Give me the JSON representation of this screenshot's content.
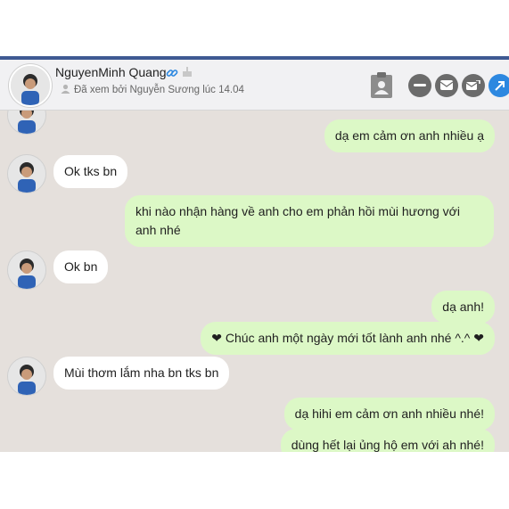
{
  "header": {
    "contact_name": "NguyenMinh Quang",
    "seen_text": "Đã xem bởi Nguyễn Sương lúc 14.04",
    "icons": [
      "verified-link-icon",
      "cake-icon",
      "clipboard-user-icon",
      "minimize-icon",
      "chat-bubbles-icon",
      "add-to-chat-icon",
      "share-icon"
    ]
  },
  "messages": [
    {
      "side": "out",
      "text": "dạ em cảm ơn anh nhiều ạ"
    },
    {
      "side": "in",
      "text": "Ok tks bn"
    },
    {
      "side": "out",
      "text": "khi nào nhận hàng về anh cho em phản hồi mùi hương với anh nhé"
    },
    {
      "side": "in",
      "text": "Ok bn"
    },
    {
      "side": "out",
      "text": "dạ anh!"
    },
    {
      "side": "out",
      "text": "❤ Chúc anh một ngày mới tốt lành anh nhé ^.^ ❤"
    },
    {
      "side": "in",
      "text": "Mùi thơm lắm nha bn tks bn"
    },
    {
      "side": "out",
      "text": "dạ hihi em cảm ơn anh nhiều nhé!"
    },
    {
      "side": "out",
      "text": "dùng hết lại ủng hộ em với ah nhé!"
    }
  ],
  "colors": {
    "incoming_bubble": "#ffffff",
    "outgoing_bubble": "#dcf8c6",
    "chat_background": "#e5e0dc",
    "accent": "#2d88e0"
  }
}
